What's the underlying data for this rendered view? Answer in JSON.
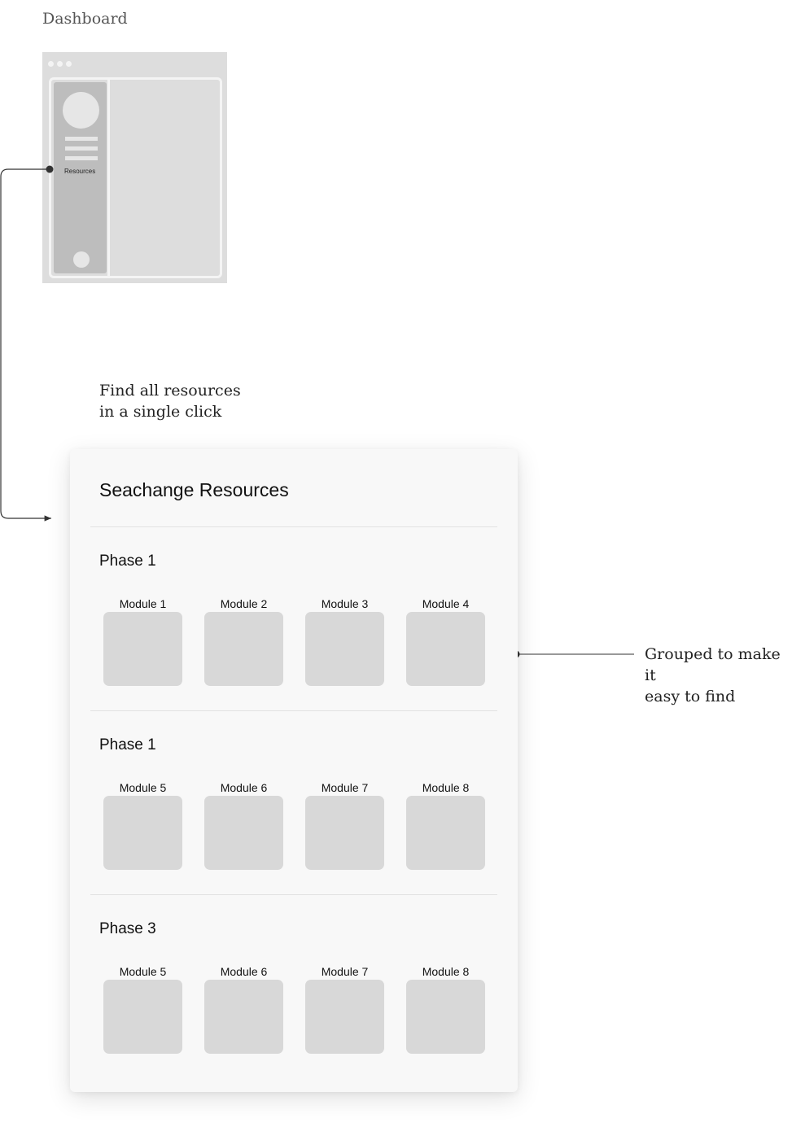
{
  "dashboard": {
    "title": "Dashboard",
    "thumbnail": {
      "sidebar_label": "Resources"
    }
  },
  "annotations": {
    "find_resources": "Find all resources\nin a single click",
    "grouped": "Grouped to make it\neasy to find"
  },
  "panel": {
    "title": "Seachange Resources",
    "groups": [
      {
        "name": "Phase 1",
        "modules": [
          "Module 1",
          "Module 2",
          "Module 3",
          "Module 4"
        ]
      },
      {
        "name": "Phase 1",
        "modules": [
          "Module 5",
          "Module 6",
          "Module 7",
          "Module 8"
        ]
      },
      {
        "name": "Phase 3",
        "modules": [
          "Module 5",
          "Module 6",
          "Module 7",
          "Module 8"
        ]
      }
    ]
  },
  "colors": {
    "tile": "#d8d8d8",
    "card": "#f8f8f8",
    "connector": "#333333"
  }
}
